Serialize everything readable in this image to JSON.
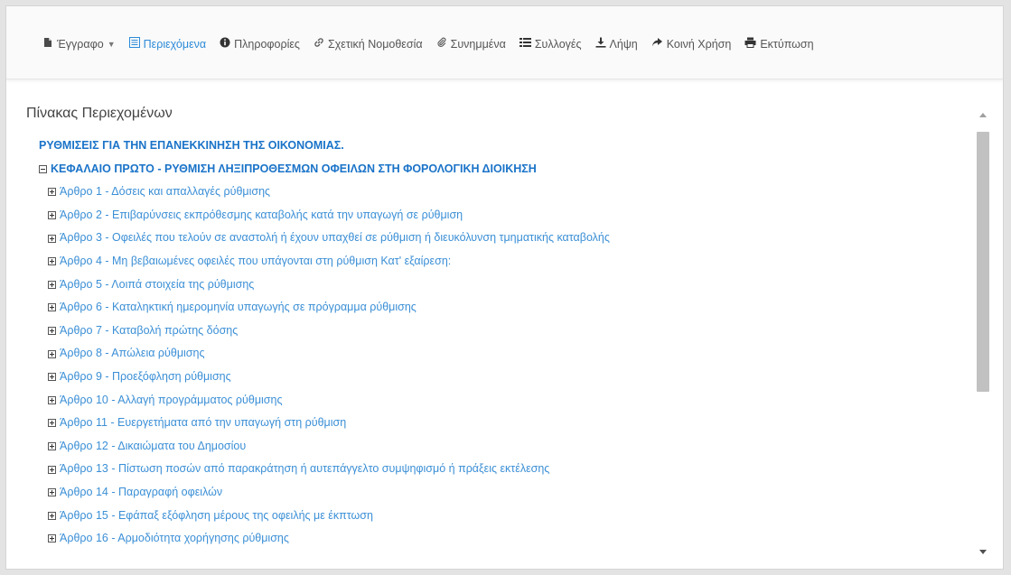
{
  "toolbar": {
    "tabs": [
      {
        "label": "Έγγραφο",
        "icon": "document-icon"
      },
      {
        "label": "Περιεχόμενα",
        "icon": "list-icon",
        "active": true
      },
      {
        "label": "Πληροφορίες",
        "icon": "info-icon"
      },
      {
        "label": "Σχετική Νομοθεσία",
        "icon": "link-icon"
      },
      {
        "label": "Συνημμένα",
        "icon": "paperclip-icon"
      },
      {
        "label": "Συλλογές",
        "icon": "collection-icon"
      },
      {
        "label": "Λήψη",
        "icon": "download-icon"
      },
      {
        "label": "Κοινή Χρήση",
        "icon": "share-icon"
      },
      {
        "label": "Εκτύπωση",
        "icon": "print-icon"
      }
    ]
  },
  "toc": {
    "heading": "Πίνακας Περιεχομένων",
    "root": "ΡΥΘΜΙΣΕΙΣ ΓΙΑ ΤΗΝ ΕΠΑΝΕΚΚΙΝΗΣΗ ΤΗΣ ΟΙΚΟΝΟΜΙΑΣ.",
    "chapter": "ΚΕΦΑΛΑΙΟ ΠΡΩΤΟ - ΡΥΘΜΙΣΗ ΛΗΞΙΠΡΟΘΕΣΜΩΝ ΟΦΕΙΛΩΝ ΣΤΗ ΦΟΡΟΛΟΓΙΚΗ ΔΙΟΙΚΗΣΗ",
    "articles": [
      "Άρθρο 1 - Δόσεις και απαλλαγές ρύθμισης",
      "Άρθρο 2 - Επιβαρύνσεις εκπρόθεσμης καταβολής κατά την υπαγωγή σε ρύθμιση",
      "Άρθρο 3 - Οφειλές που τελούν σε αναστολή ή έχουν υπαχθεί σε ρύθμιση ή διευκόλυνση τμηματικής καταβολής",
      "Άρθρο 4 - Μη βεβαιωμένες οφειλές που υπάγονται στη ρύθμιση Κατ' εξαίρεση:",
      "Άρθρο 5 - Λοιπά στοιχεία της ρύθμισης",
      "Άρθρο 6 - Καταληκτική ημερομηνία υπαγωγής σε πρόγραμμα ρύθμισης",
      "Άρθρο 7 - Καταβολή πρώτης δόσης",
      "Άρθρο 8 - Απώλεια ρύθμισης",
      "Άρθρο 9 - Προεξόφληση ρύθμισης",
      "Άρθρο 10 - Αλλαγή προγράμματος ρύθμισης",
      "Άρθρο 11 - Ευεργετήματα από την υπαγωγή στη ρύθμιση",
      "Άρθρο 12 - Δικαιώματα του Δημοσίου",
      "Άρθρο 13 - Πίστωση ποσών από παρακράτηση ή αυτεπάγγελτο συμψηφισμό ή πράξεις εκτέλεσης",
      "Άρθρο 14 - Παραγραφή οφειλών",
      "Άρθρο 15 - Εφάπαξ εξόφληση μέρους της οφειλής με έκπτωση",
      "Άρθρο 16 - Αρμοδιότητα χορήγησης ρύθμισης"
    ]
  },
  "colors": {
    "link": "#3b8fd6",
    "link_strong": "#1a73c8",
    "active_tab": "#2d8bd8"
  }
}
